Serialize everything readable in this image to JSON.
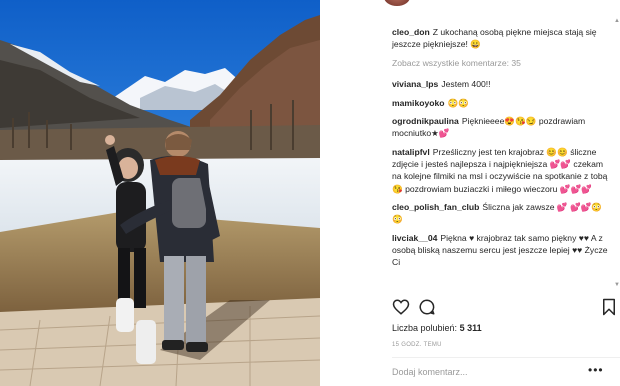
{
  "photo": {
    "icon": "travel-photo",
    "colors": {
      "sky": "#1f6fd0",
      "snow": "#eef3f8",
      "grass": "#9a7a4a",
      "mountain": "#3d3a36"
    }
  },
  "comments": {
    "caption": {
      "user": "cleo_don",
      "text": "Z ukochaną osobą piękne miejsca stają się jeszcze piękniejsze! 😀"
    },
    "view_all": "Zobacz wszystkie komentarze: 35",
    "items": [
      {
        "user": "viviana_lps",
        "text": "Jestem 400!!"
      },
      {
        "user": "mamikoyoko",
        "text": "😳😳"
      },
      {
        "user": "ogrodnikpaulina",
        "text": "Pięknieeee😍😘😏 pozdrawiam mocniutko★💕"
      },
      {
        "user": "natalipfvl",
        "text": "Prześliczny jest ten krajobraz 😊😊 śliczne zdjęcie i jesteś najlepsza i najpiękniejsza 💕💕 czekam na kolejne filmiki na msl i oczywiście na spotkanie z tobą 😘 pozdrowiam buziaczki i miłego wieczoru 💕💕💕"
      },
      {
        "user": "cleo_polish_fan_club",
        "text": "Śliczna jak zawsze 💕 💕💕😳😳"
      },
      {
        "user": "livciak__04",
        "text": "Piękna ♥ krajobraz tak samo piękny ♥♥ A z osobą bliską naszemu sercu jest jeszcze lepiej ♥♥ Życze Ci"
      }
    ]
  },
  "actions": {
    "like_icon": "heart-icon",
    "comment_icon": "comment-icon",
    "save_icon": "bookmark-icon"
  },
  "likes": {
    "label": "Liczba polubień:",
    "count": "5 311"
  },
  "time": "15 GODZ. TEMU",
  "add_comment": {
    "placeholder": "Dodaj komentarz...",
    "more": "•••"
  }
}
